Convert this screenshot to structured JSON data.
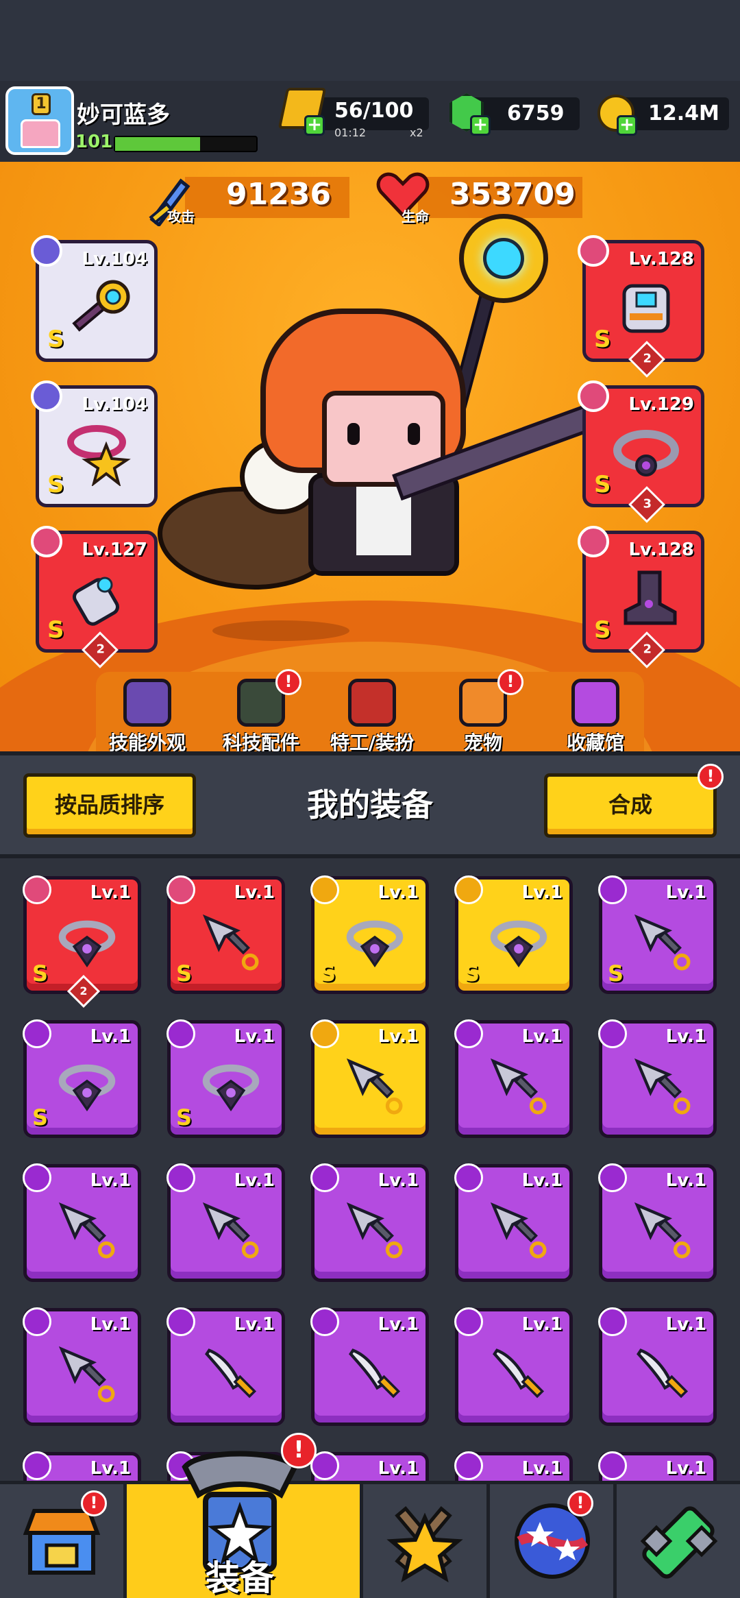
{
  "player": {
    "name": "妙可蓝多",
    "level": "101",
    "avatar_badge": "1",
    "xp_fraction": 0.6
  },
  "resources": {
    "energy": {
      "value": "56/100",
      "timer": "01:12",
      "multiplier": "x2"
    },
    "gems": "6759",
    "coins": "12.4M"
  },
  "stats": {
    "attack": {
      "label": "攻击",
      "value": "91236"
    },
    "health": {
      "label": "生命",
      "value": "353709"
    }
  },
  "equipped": {
    "weapon": {
      "level": "Lv.104",
      "grade": "S"
    },
    "necklace": {
      "level": "Lv.104",
      "grade": "S"
    },
    "gloves": {
      "level": "Lv.127",
      "grade": "S",
      "stars": "2"
    },
    "armor": {
      "level": "Lv.128",
      "grade": "S",
      "stars": "2"
    },
    "belt": {
      "level": "Lv.129",
      "grade": "S",
      "stars": "3"
    },
    "boots": {
      "level": "Lv.128",
      "grade": "S",
      "stars": "2"
    }
  },
  "features": [
    {
      "label": "技能外观",
      "icon": "skin-icon",
      "alert": false
    },
    {
      "label": "科技配件",
      "icon": "tech-icon",
      "alert": true
    },
    {
      "label": "特工/装扮",
      "icon": "agent-icon",
      "alert": false
    },
    {
      "label": "宠物",
      "icon": "pet-icon",
      "alert": true
    },
    {
      "label": "收藏馆",
      "icon": "collection-icon",
      "alert": false
    }
  ],
  "equipment_section": {
    "sort_button": "按品质排序",
    "title": "我的装备",
    "merge_button": "合成",
    "alert_mark": "!"
  },
  "inventory_level": "Lv.1",
  "inventory_grade": "S",
  "inventory_stars": "2",
  "colors": {
    "purple": "#b44be0",
    "gold": "#ffd21a",
    "red": "#f0323a",
    "orange_bg": "#f79a14"
  },
  "bottom_nav": {
    "active_tab": "装备",
    "tabs": [
      "shop-icon",
      "equipment-icon",
      "battle-icon",
      "planet-icon",
      "dna-icon"
    ]
  }
}
